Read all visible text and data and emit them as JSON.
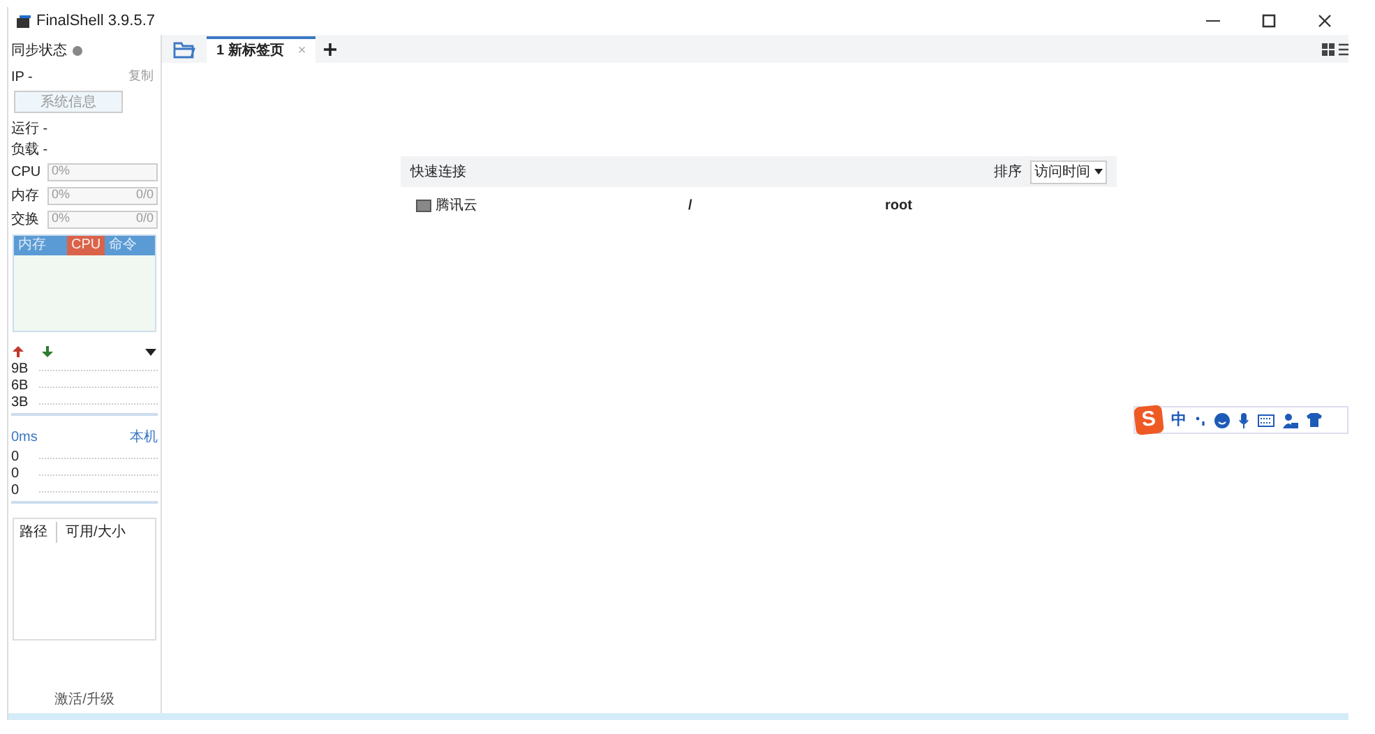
{
  "window": {
    "title": "FinalShell 3.9.5.7"
  },
  "sidebar": {
    "sync_label": "同步状态",
    "ip_label": "IP -",
    "copy_link": "复制",
    "sysinfo_button": "系统信息",
    "run_label": "运行 -",
    "load_label": "负载 -",
    "meters": [
      {
        "label": "CPU",
        "value": "0%"
      },
      {
        "label": "内存",
        "value": "0%",
        "total": "0/0"
      },
      {
        "label": "交换",
        "value": "0%",
        "total": "0/0"
      }
    ],
    "process_tabs": [
      {
        "label": "内存",
        "selected": false
      },
      {
        "label": "CPU",
        "selected": true
      },
      {
        "label": "命令",
        "selected": false
      }
    ],
    "net_ticks": [
      "9B",
      "6B",
      "3B"
    ],
    "ping_label": "0ms",
    "ping_target": "本机",
    "ping_ticks": [
      "0",
      "0",
      "0"
    ],
    "disk_columns": [
      "路径",
      "可用/大小"
    ],
    "activate_link": "激活/升级"
  },
  "tabs": [
    {
      "label": "1 新标签页",
      "selected": true,
      "close": "×"
    }
  ],
  "quick_connect": {
    "title": "快速连接",
    "sort_label": "排序",
    "sort_value": "访问时间",
    "rows": [
      {
        "name": "腾讯云",
        "path": "/",
        "user": "root"
      }
    ]
  },
  "ime_toolbar": {
    "logo": "S",
    "mode": "中"
  }
}
